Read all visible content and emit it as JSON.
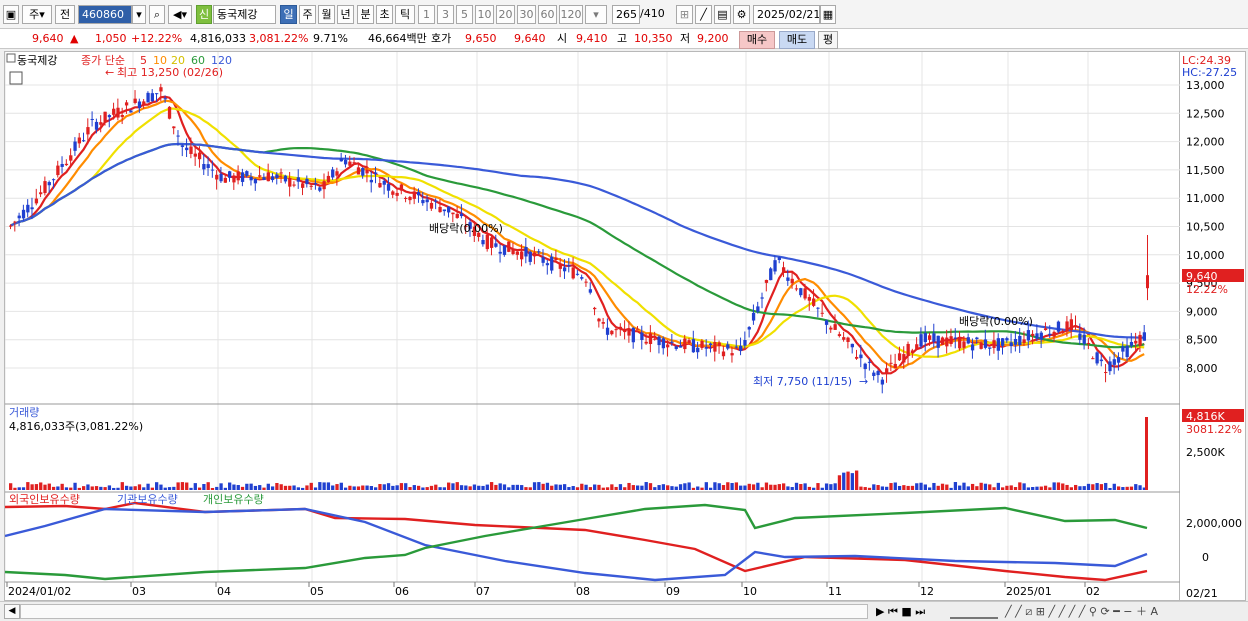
{
  "toolbar": {
    "mode": "주",
    "prev": "전",
    "code": "460860",
    "new_tag": "신",
    "name": "동국제강",
    "periods": [
      "일",
      "주",
      "월",
      "년",
      "분",
      "초",
      "틱"
    ],
    "active_period": "일",
    "intervals": [
      "1",
      "3",
      "5",
      "10",
      "20",
      "30",
      "60",
      "120"
    ],
    "count": "265",
    "count_total": "/410",
    "date": "2025/02/21"
  },
  "info": {
    "price": "9,640",
    "arrow": "▲",
    "change": "1,050",
    "change_pct": "+12.22%",
    "volume": "4,816,033",
    "volume_pct": "3,081.22%",
    "turnover": "9.71%",
    "amount": "46,664백만",
    "quote_label": "호가",
    "ask": "9,650",
    "bid": "9,640",
    "open_label": "시",
    "open": "9,410",
    "high_label": "고",
    "high": "10,350",
    "low_label": "저",
    "low": "9,200",
    "buy": "매수",
    "sell": "매도",
    "avg": "평"
  },
  "legend": {
    "name": "동국제강",
    "price_label": "종가 단순",
    "ma_labels": [
      "5",
      "10",
      "20",
      "60",
      "120"
    ],
    "ma_colors": [
      "#e02020",
      "#ff8c00",
      "#f0e000",
      "#2a9a3a",
      "#3a5ad8"
    ],
    "lc": "LC:24.39",
    "hc": "HC:-27.25"
  },
  "annotations": {
    "high": "최고 13,250 (02/26)",
    "low": "최저 7,750 (11/15)",
    "dividend1": "배당락(0.00%)",
    "dividend2": "배당락(0.00%)"
  },
  "volume_panel": {
    "title": "거래량",
    "value": "4,816,033주(3,081.22%)",
    "last_label": "4,816K",
    "last_pct": "3081.22%",
    "tick": "2,500K"
  },
  "holdings_panel": {
    "labels": [
      "외국인보유수량",
      "기관보유수량",
      "개인보유수량"
    ],
    "colors": [
      "#e02020",
      "#3a5ad8",
      "#2a9a3a"
    ],
    "ticks": [
      "2,000,000",
      "0"
    ]
  },
  "price_axis": {
    "ticks": [
      "13,000",
      "12,500",
      "12,000",
      "11,500",
      "11,000",
      "10,500",
      "10,000",
      "9,500",
      "9,000",
      "8,500",
      "8,000"
    ],
    "last_price": "9,640",
    "last_pct": "12.22%"
  },
  "x_axis": {
    "labels": [
      "2024/01/02",
      "03",
      "04",
      "05",
      "06",
      "07",
      "08",
      "09",
      "10",
      "11",
      "12",
      "2025/01",
      "02",
      "02/21"
    ]
  },
  "chart_data": {
    "type": "candlestick",
    "title": "동국제강",
    "ylim": [
      7700,
      13200
    ],
    "high_label": "최고 13,250 (02/26)",
    "low_label": "최저 7,750 (11/15)",
    "close_series": [
      {
        "date": "2024-01-02",
        "close": 10500
      },
      {
        "date": "2024-01-15",
        "close": 11200
      },
      {
        "date": "2024-02-01",
        "close": 12300
      },
      {
        "date": "2024-02-26",
        "close": 12900
      },
      {
        "date": "2024-03-05",
        "close": 11900
      },
      {
        "date": "2024-03-20",
        "close": 11350
      },
      {
        "date": "2024-04-05",
        "close": 11400
      },
      {
        "date": "2024-04-25",
        "close": 11150
      },
      {
        "date": "2024-05-03",
        "close": 11700
      },
      {
        "date": "2024-05-20",
        "close": 11200
      },
      {
        "date": "2024-06-10",
        "close": 10800
      },
      {
        "date": "2024-06-25",
        "close": 10200
      },
      {
        "date": "2024-07-10",
        "close": 10000
      },
      {
        "date": "2024-07-31",
        "close": 9600
      },
      {
        "date": "2024-08-05",
        "close": 8700
      },
      {
        "date": "2024-08-20",
        "close": 8550
      },
      {
        "date": "2024-09-05",
        "close": 8400
      },
      {
        "date": "2024-09-25",
        "close": 8300
      },
      {
        "date": "2024-10-08",
        "close": 9900
      },
      {
        "date": "2024-10-25",
        "close": 8900
      },
      {
        "date": "2024-11-15",
        "close": 7800
      },
      {
        "date": "2024-11-29",
        "close": 8500
      },
      {
        "date": "2024-12-15",
        "close": 8450
      },
      {
        "date": "2024-12-30",
        "close": 8400
      },
      {
        "date": "2025-01-10",
        "close": 8600
      },
      {
        "date": "2025-01-24",
        "close": 8750
      },
      {
        "date": "2025-02-05",
        "close": 8000
      },
      {
        "date": "2025-02-20",
        "close": 8590
      },
      {
        "date": "2025-02-21",
        "close": 9640
      }
    ]
  }
}
